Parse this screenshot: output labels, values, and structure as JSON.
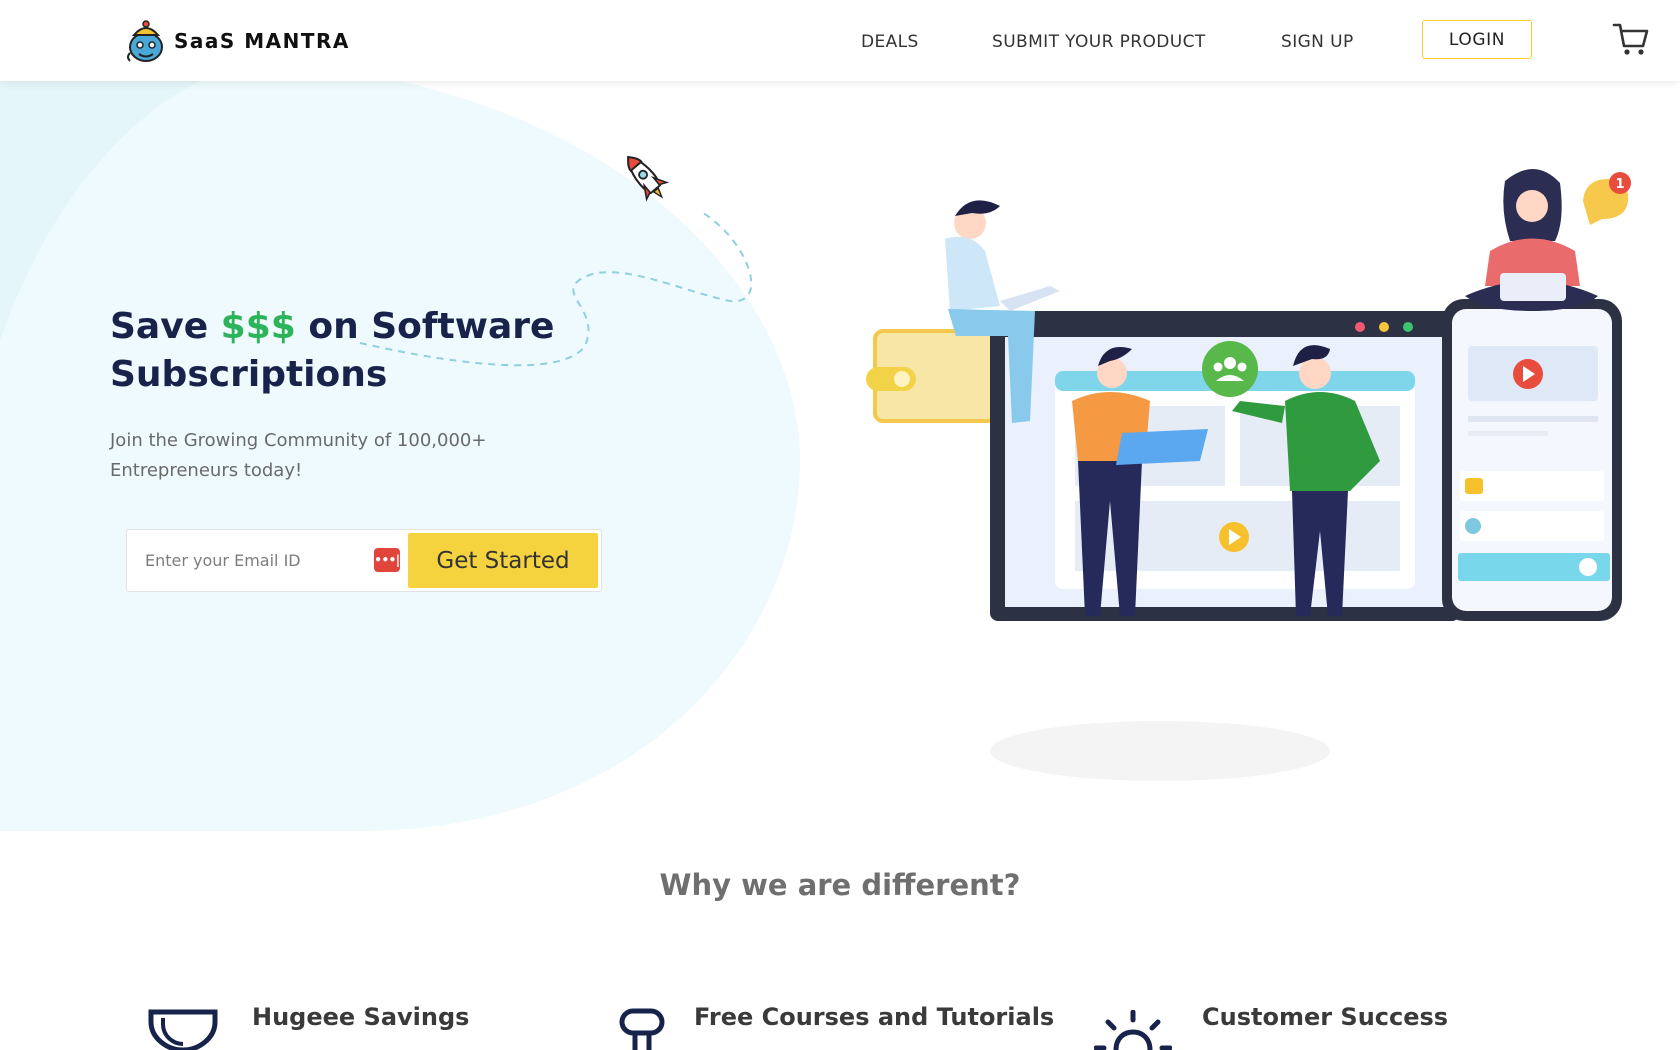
{
  "header": {
    "brand": "SaaS MANTRA",
    "nav": {
      "deals": "DEALS",
      "submit": "SUBMIT YOUR PRODUCT",
      "signup": "SIGN UP",
      "login": "LOGIN"
    }
  },
  "hero": {
    "title_part1": "Save ",
    "title_money": "$$$",
    "title_part2": " on Software Subscriptions",
    "subtitle": "Join the Growing Community of 100,000+ Entrepreneurs today!",
    "email_placeholder": "Enter your Email ID",
    "password_manager_icon_text": "•••|",
    "cta": "Get Started",
    "notification_count": "1"
  },
  "why": {
    "title": "Why we are different?",
    "features": [
      {
        "label": "Hugeee Savings",
        "icon": "trophy-icon"
      },
      {
        "label": "Free Courses and Tutorials",
        "icon": "keyhole-icon"
      },
      {
        "label": "Customer Success",
        "icon": "lightbulb-icon"
      }
    ]
  },
  "colors": {
    "accent_yellow": "#f5d33e",
    "money_green": "#2db35a",
    "title_navy": "#17234a",
    "hero_bg": "#eefafd"
  }
}
